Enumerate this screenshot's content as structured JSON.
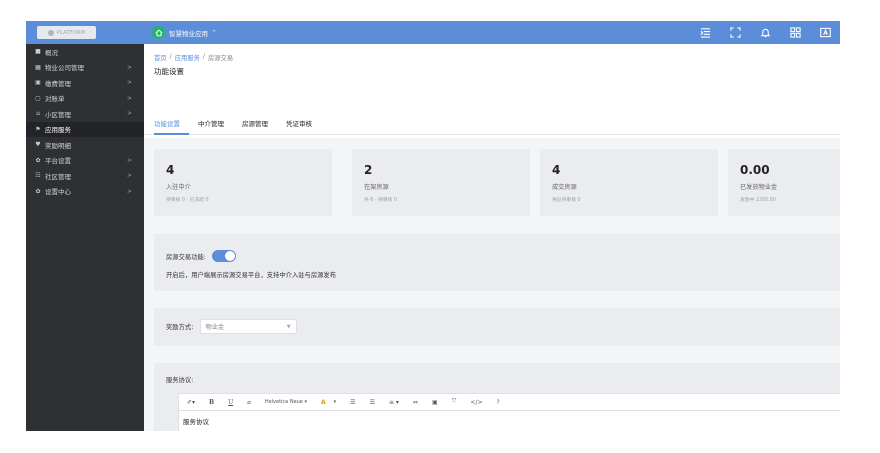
{
  "header": {
    "logo_text": "PLATFORM",
    "app_name": "智慧物业应用",
    "app_caret": "^",
    "icons": [
      "menu-fold-icon",
      "fullscreen-icon",
      "bell-icon",
      "grid-apps-icon",
      "language-a-icon"
    ],
    "color": "#5b8dd9"
  },
  "sidebar": {
    "items": [
      {
        "icon": "■",
        "label": "概况",
        "chevron": ""
      },
      {
        "icon": "▦",
        "label": "物业公司管理",
        "chevron": ">"
      },
      {
        "icon": "▣",
        "label": "缴费管理",
        "chevron": ">"
      },
      {
        "icon": "▢",
        "label": "对账单",
        "chevron": ">"
      },
      {
        "icon": "⌂",
        "label": "小区管理",
        "chevron": ">"
      },
      {
        "icon": "⚑",
        "label": "应用服务",
        "chevron": ""
      },
      {
        "icon": "♥",
        "label": "奖励明细",
        "chevron": ""
      },
      {
        "icon": "✿",
        "label": "平台设置",
        "chevron": ">"
      },
      {
        "icon": "☷",
        "label": "社区管理",
        "chevron": ">"
      },
      {
        "icon": "✿",
        "label": "设置中心",
        "chevron": ">"
      }
    ],
    "active_index": 5
  },
  "breadcrumb": {
    "home": "首页",
    "sep": "/",
    "app": "应用服务",
    "current": "房源交易"
  },
  "page_title": "功能设置",
  "tabs": [
    "功能设置",
    "中介管理",
    "房源管理",
    "凭证审核"
  ],
  "active_tab": 0,
  "stats": [
    {
      "value": "4",
      "label": "入驻中介",
      "sub": "待审核 0 · 已冻结 0"
    },
    {
      "value": "2",
      "label": "在架房源",
      "sub": "共 6 · 待审核 0"
    },
    {
      "value": "4",
      "label": "成交房源",
      "sub": "凭证待审核 0"
    },
    {
      "value": "0.00",
      "label": "已发放物业金",
      "sub": "发放中 2200.00"
    }
  ],
  "feature": {
    "label": "房源交易功能:",
    "enabled": true,
    "description": "开启后，用户端展示房源交易平台，支持中介入驻与房源发布"
  },
  "reward": {
    "label": "奖励方式:",
    "selected": "物业金"
  },
  "agreement": {
    "label": "服务协议:",
    "toolbar": [
      "✐▾",
      "B",
      "U",
      "⌀",
      "Helvetica Neue ▾",
      "A",
      "▾",
      "☰",
      "☰",
      "≡ ▾",
      "⇔",
      "▣",
      "⤧",
      "</>",
      "?"
    ],
    "content": "服务协议"
  }
}
